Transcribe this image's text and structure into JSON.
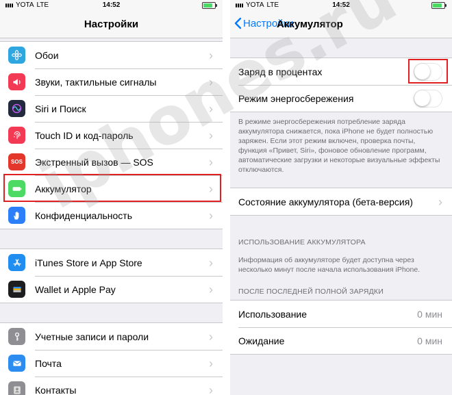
{
  "status_left": {
    "carrier": "YOTA",
    "network": "LTE",
    "time": "14:52"
  },
  "status_right": {
    "carrier": "YOTA",
    "network": "LTE",
    "time": "14:52"
  },
  "settings": {
    "title": "Настройки",
    "items": [
      {
        "label": "Обои",
        "icon": "wallpaper-icon",
        "color": "#2ea6e0"
      },
      {
        "label": "Звуки, тактильные сигналы",
        "icon": "sounds-icon",
        "color": "#f23a54"
      },
      {
        "label": "Siri и Поиск",
        "icon": "siri-icon",
        "color": "#232a3d"
      },
      {
        "label": "Touch ID и код-пароль",
        "icon": "fingerprint-icon",
        "color": "#f23a54"
      },
      {
        "label": "Экстренный вызов — SOS",
        "icon_text": "SOS",
        "icon": "sos-icon",
        "color": "#e4372c"
      },
      {
        "label": "Аккумулятор",
        "icon": "battery-icon",
        "color": "#4cd964"
      },
      {
        "label": "Конфиденциальность",
        "icon": "privacy-hand-icon",
        "color": "#2d7ff9"
      }
    ],
    "items2": [
      {
        "label": "iTunes Store и App Store",
        "icon": "app-store-icon",
        "color": "#1f8ef0"
      },
      {
        "label": "Wallet и Apple Pay",
        "icon": "wallet-icon",
        "color": "#1d1d1f"
      }
    ],
    "items3": [
      {
        "label": "Учетные записи и пароли",
        "icon": "key-icon",
        "color": "#8e8e93"
      },
      {
        "label": "Почта",
        "icon": "mail-icon",
        "color": "#2d8cf0"
      },
      {
        "label": "Контакты",
        "icon": "contacts-icon",
        "color": "#8e8e93"
      }
    ]
  },
  "battery_screen": {
    "back_label": "Настройки",
    "title": "Аккумулятор",
    "percentage_label": "Заряд в процентах",
    "percentage_on": false,
    "low_power_label": "Режим энергосбережения",
    "low_power_on": false,
    "low_power_note": "В режиме энергосбережения потребление заряда аккумулятора снижается, пока iPhone не будет полностью заряжен. Если этот режим включен, проверка почты, функция «Привет, Siri», фоновое обновление программ, автоматические загрузки и некоторые визуальные эффекты отключаются.",
    "health_label": "Состояние аккумулятора (бета-версия)",
    "usage_header": "ИСПОЛЬЗОВАНИЕ АККУМУЛЯТОРА",
    "usage_note": "Информация об аккумуляторе будет доступна через несколько минут после начала использования iPhone.",
    "since_header": "ПОСЛЕ ПОСЛЕДНЕЙ ПОЛНОЙ ЗАРЯДКИ",
    "since_rows": [
      {
        "label": "Использование",
        "value": "0 мин"
      },
      {
        "label": "Ожидание",
        "value": "0 мин"
      }
    ]
  },
  "watermark": "iphones.ru"
}
